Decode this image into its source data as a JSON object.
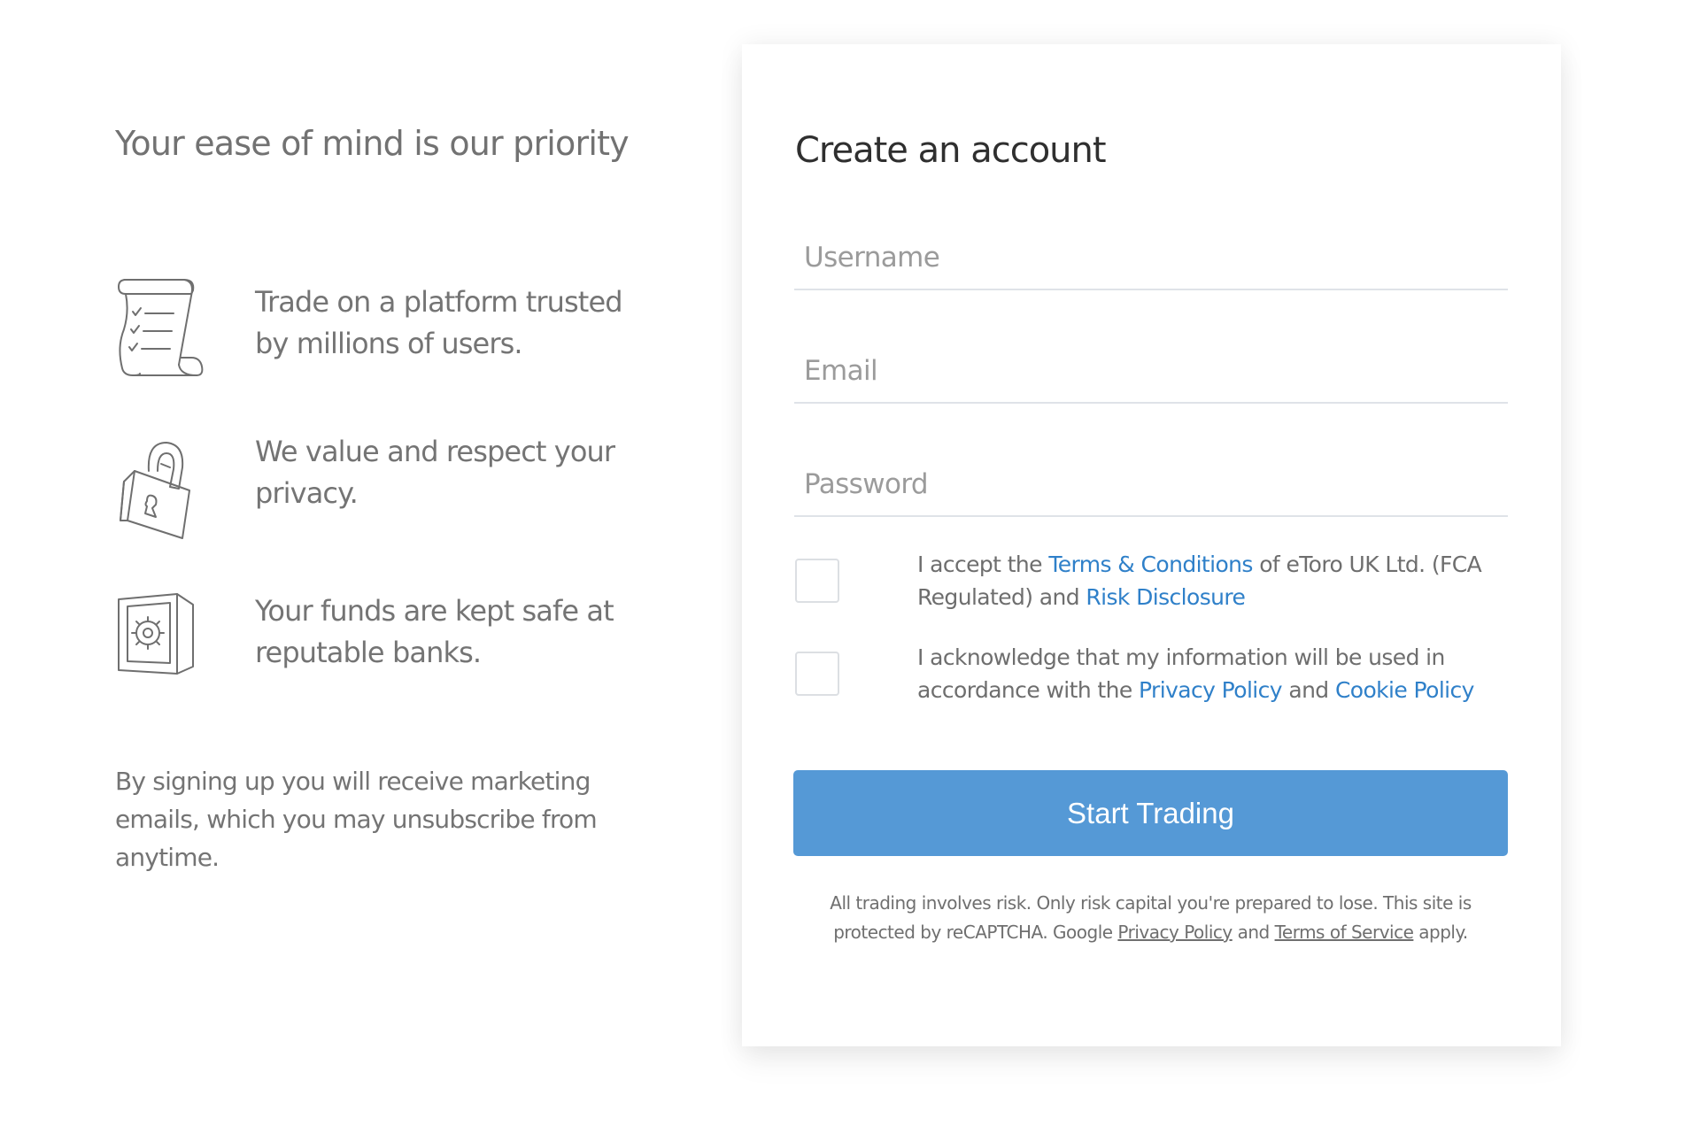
{
  "left_panel": {
    "title": "Your ease of mind is our priority",
    "features": [
      {
        "icon": "scroll-checklist-icon",
        "text": "Trade on a platform trusted by millions of users."
      },
      {
        "icon": "padlock-icon",
        "text": "We value and respect your privacy."
      },
      {
        "icon": "safe-icon",
        "text": "Your funds are kept safe at reputable banks."
      }
    ],
    "marketing_note": "By signing up you will receive marketing emails, which you may unsubscribe from anytime."
  },
  "form": {
    "title": "Create an account",
    "fields": {
      "username": {
        "placeholder": "Username",
        "value": ""
      },
      "email": {
        "placeholder": "Email",
        "value": ""
      },
      "password": {
        "placeholder": "Password",
        "value": ""
      }
    },
    "consents": [
      {
        "checked": false,
        "prefix": "I accept the ",
        "link1": "Terms & Conditions",
        "middle": " of eToro UK Ltd. (FCA Regulated) and ",
        "link2": "Risk Disclosure",
        "suffix": ""
      },
      {
        "checked": false,
        "prefix": "I acknowledge that my information will be used in accordance with the ",
        "link1": "Privacy Policy",
        "middle": " and ",
        "link2": "Cookie Policy",
        "suffix": ""
      }
    ],
    "submit_label": "Start Trading",
    "disclaimer": {
      "text1": "All trading involves risk. Only risk capital you're prepared to lose. This site is protected by reCAPTCHA. Google ",
      "link1": "Privacy Policy",
      "text2": " and ",
      "link2": "Terms of Service",
      "text3": " apply."
    }
  },
  "colors": {
    "button": "#5599d6",
    "link": "#2f80c9",
    "body_text": "#6b6b6b",
    "placeholder": "#9b9b9b",
    "title": "#2f2f2f"
  }
}
